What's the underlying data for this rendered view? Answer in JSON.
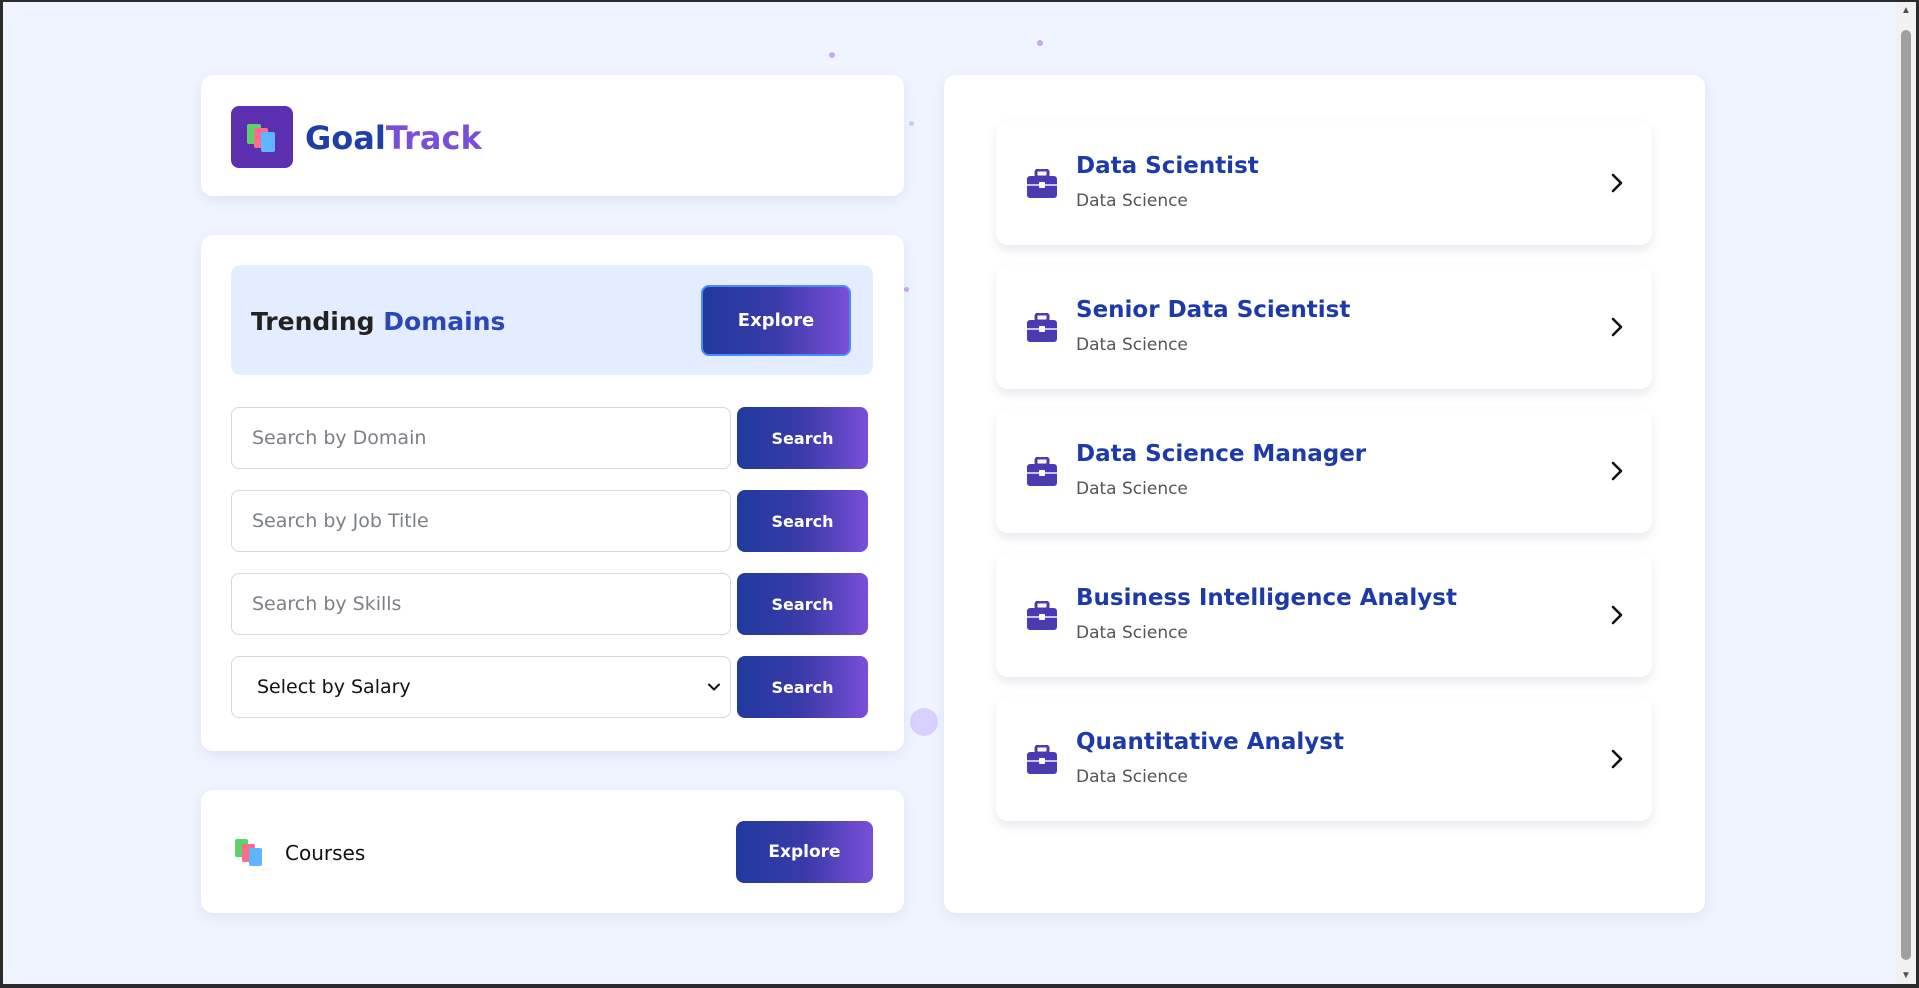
{
  "brand": {
    "part1": "Goal",
    "part2": "Track"
  },
  "trending": {
    "title_part1": "Trending",
    "title_part2": "Domains",
    "explore_label": "Explore"
  },
  "search": {
    "domain_placeholder": "Search by Domain",
    "job_title_placeholder": "Search by Job Title",
    "skills_placeholder": "Search by Skills",
    "salary_selected": "Select by Salary",
    "button_label": "Search"
  },
  "courses": {
    "label": "Courses",
    "explore_label": "Explore"
  },
  "jobs": [
    {
      "title": "Data Scientist",
      "domain": "Data Science"
    },
    {
      "title": "Senior Data Scientist",
      "domain": "Data Science"
    },
    {
      "title": "Data Science Manager",
      "domain": "Data Science"
    },
    {
      "title": "Business Intelligence Analyst",
      "domain": "Data Science"
    },
    {
      "title": "Quantitative Analyst",
      "domain": "Data Science"
    }
  ],
  "icons": {
    "logo": "books-icon",
    "job": "briefcase-icon",
    "chevron": "chevron-right-icon"
  },
  "colors": {
    "accent_blue": "#1f3a9e",
    "accent_purple": "#7a4fd8",
    "background": "#f0f4ff"
  }
}
